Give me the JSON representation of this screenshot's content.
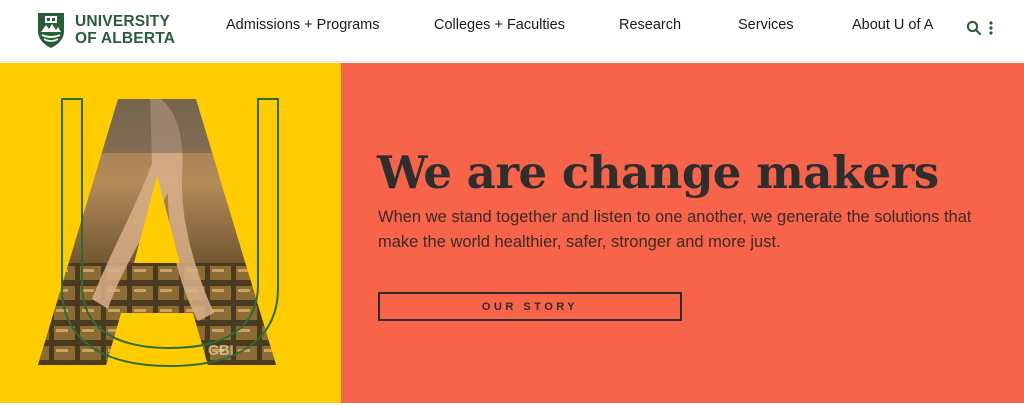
{
  "header": {
    "logo_line1": "UNIVERSITY",
    "logo_line2": "OF ALBERTA",
    "nav": [
      {
        "label": "Admissions + Programs"
      },
      {
        "label": "Colleges + Faculties"
      },
      {
        "label": "Research"
      },
      {
        "label": "Services"
      },
      {
        "label": "About U of A"
      }
    ],
    "icons": [
      "search-icon",
      "more-vertical-icon"
    ]
  },
  "hero": {
    "title": "We are change makers",
    "body": "When we stand together and listen to one another, we generate the solutions that make the world healthier, safer, stronger and more just.",
    "cta_label": "OUR STORY",
    "art_letters": [
      "U",
      "A"
    ],
    "photo_box_label": "CBI"
  },
  "colors": {
    "brand_green": "#275d38",
    "hero_yellow": "#ffcc00",
    "hero_coral": "#f8644a",
    "text_dark": "#2e2e2e"
  }
}
